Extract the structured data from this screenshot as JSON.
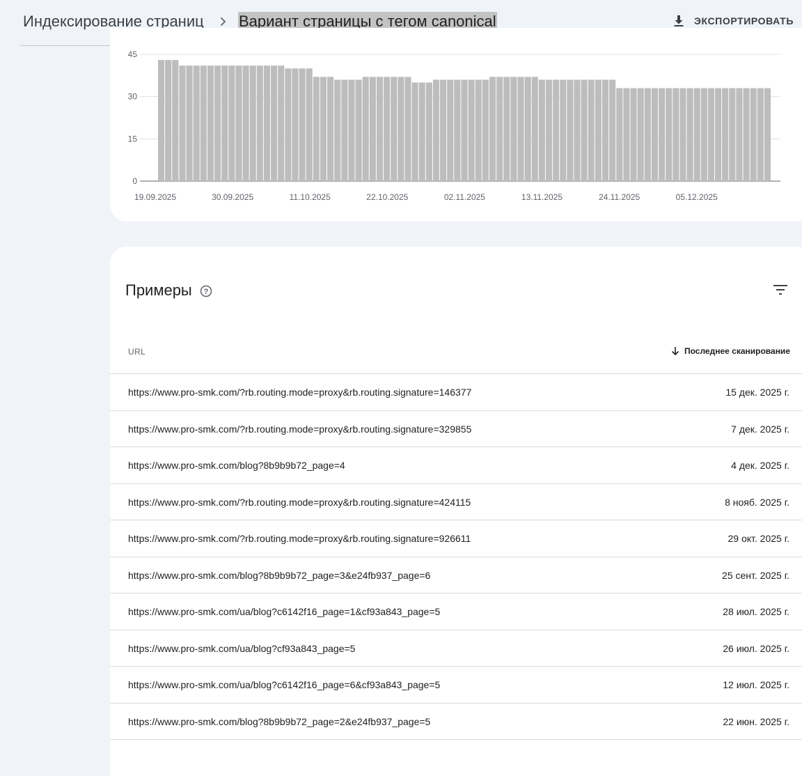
{
  "header": {
    "breadcrumb_parent": "Индексирование страниц",
    "breadcrumb_current": "Вариант страницы с тегом canonical",
    "export_label": "ЭКСПОРТИРОВАТЬ"
  },
  "chart_data": {
    "type": "bar",
    "ylim": [
      0,
      45
    ],
    "yticks": [
      "0",
      "15",
      "30",
      "45"
    ],
    "xticks": [
      "19.09.2025",
      "30.09.2025",
      "11.10.2025",
      "22.10.2025",
      "02.11.2025",
      "13.11.2025",
      "24.11.2025",
      "05.12.2025"
    ],
    "bar_color": "#bdbdbd",
    "values": [
      43,
      43,
      43,
      41,
      41,
      41,
      41,
      41,
      41,
      41,
      41,
      41,
      41,
      41,
      41,
      41,
      41,
      41,
      40,
      40,
      40,
      40,
      37,
      37,
      37,
      36,
      36,
      36,
      36,
      37,
      37,
      37,
      37,
      37,
      37,
      37,
      35,
      35,
      35,
      36,
      36,
      36,
      36,
      36,
      36,
      36,
      36,
      37,
      37,
      37,
      37,
      37,
      37,
      37,
      36,
      36,
      36,
      36,
      36,
      36,
      36,
      36,
      36,
      36,
      36,
      33,
      33,
      33,
      33,
      33,
      33,
      33,
      33,
      33,
      33,
      33,
      33,
      33,
      33,
      33,
      33,
      33,
      33,
      33,
      33,
      33,
      33
    ]
  },
  "examples": {
    "title": "Примеры",
    "col_url": "URL",
    "col_last_crawl": "Последнее сканирование",
    "rows": [
      {
        "url": "https://www.pro-smk.com/?rb.routing.mode=proxy&rb.routing.signature=146377",
        "date": "15 дек. 2025 г."
      },
      {
        "url": "https://www.pro-smk.com/?rb.routing.mode=proxy&rb.routing.signature=329855",
        "date": "7 дек. 2025 г."
      },
      {
        "url": "https://www.pro-smk.com/blog?8b9b9b72_page=4",
        "date": "4 дек. 2025 г."
      },
      {
        "url": "https://www.pro-smk.com/?rb.routing.mode=proxy&rb.routing.signature=424115",
        "date": "8 нояб. 2025 г."
      },
      {
        "url": "https://www.pro-smk.com/?rb.routing.mode=proxy&rb.routing.signature=926611",
        "date": "29 окт. 2025 г."
      },
      {
        "url": "https://www.pro-smk.com/blog?8b9b9b72_page=3&e24fb937_page=6",
        "date": "25 сент. 2025 г."
      },
      {
        "url": "https://www.pro-smk.com/ua/blog?c6142f16_page=1&cf93a843_page=5",
        "date": "28 июл. 2025 г."
      },
      {
        "url": "https://www.pro-smk.com/ua/blog?cf93a843_page=5",
        "date": "26 июл. 2025 г."
      },
      {
        "url": "https://www.pro-smk.com/ua/blog?c6142f16_page=6&cf93a843_page=5",
        "date": "12 июл. 2025 г."
      },
      {
        "url": "https://www.pro-smk.com/blog?8b9b9b72_page=2&e24fb937_page=5",
        "date": "22 июн. 2025 г."
      }
    ]
  }
}
